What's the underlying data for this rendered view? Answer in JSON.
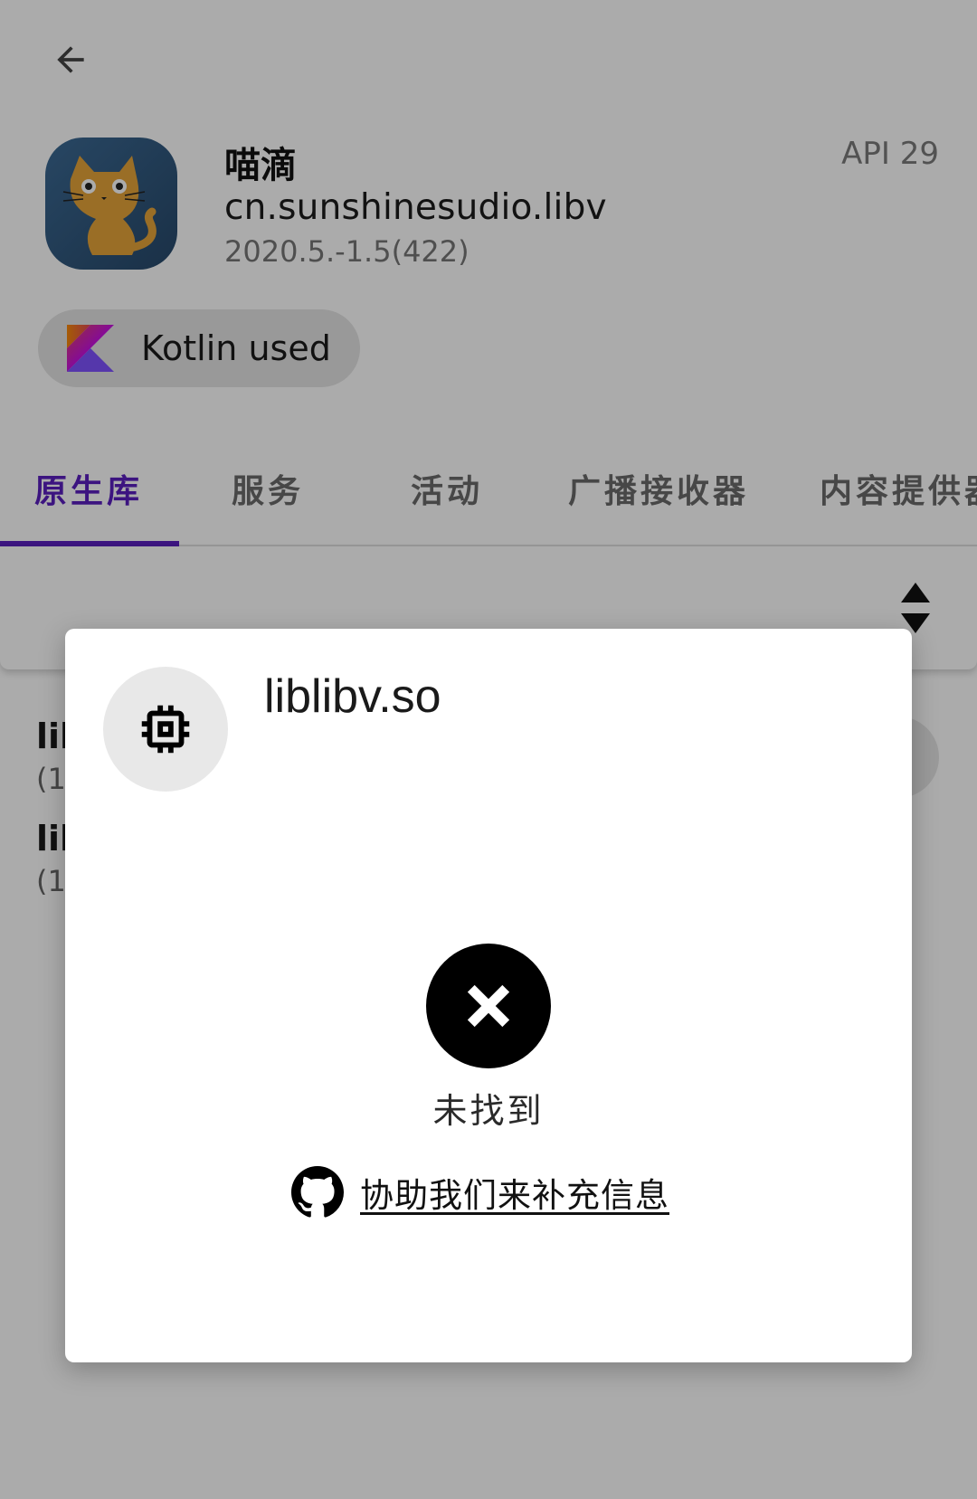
{
  "app": {
    "name": "喵滴",
    "package": "cn.sunshinesudio.libv",
    "version": "2020.5.-1.5(422)",
    "api": "API 29"
  },
  "chip": {
    "label": "Kotlin used"
  },
  "tabs": [
    {
      "label": "原生库",
      "active": true
    },
    {
      "label": "服务"
    },
    {
      "label": "活动"
    },
    {
      "label": "广播接收器"
    },
    {
      "label": "内容提供器"
    }
  ],
  "list": {
    "items": [
      {
        "name": "lib",
        "size": "(1"
      },
      {
        "name": "lib",
        "size": "(1"
      }
    ]
  },
  "dialog": {
    "title": "liblibv.so",
    "status": "未找到",
    "help_link": "协助我们来补充信息"
  },
  "colors": {
    "accent": "#5a1fbf",
    "scrim": "#ababab"
  },
  "icons": [
    "back-arrow-icon",
    "cat-app-icon",
    "kotlin-icon",
    "sort-icon",
    "chip-icon",
    "close-icon",
    "github-icon"
  ]
}
